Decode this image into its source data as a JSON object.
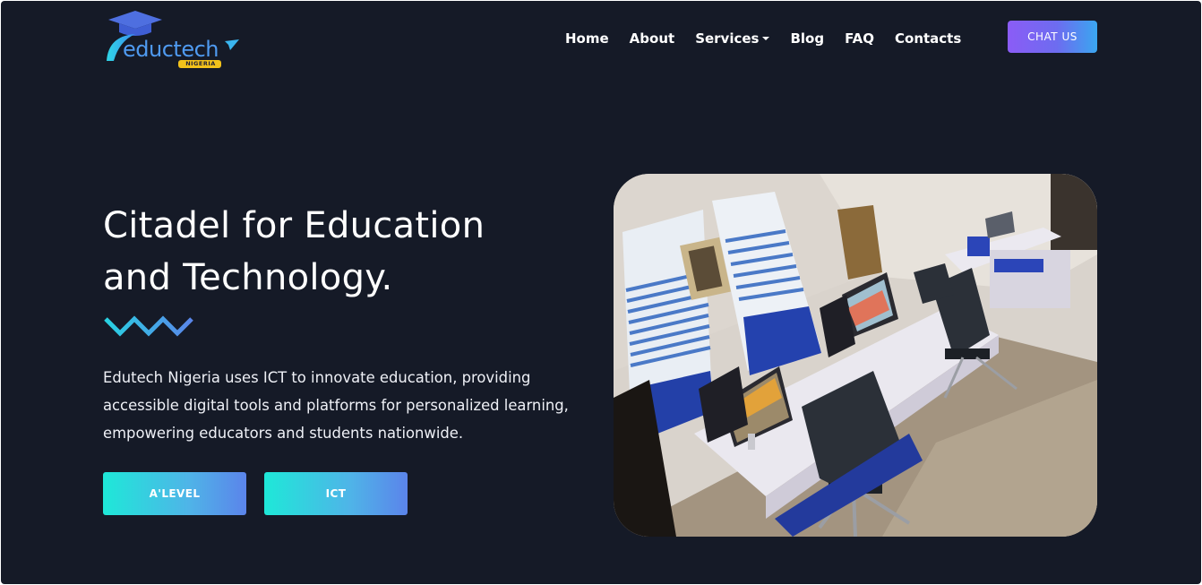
{
  "brand": {
    "logo_text": "eductech",
    "logo_sub": "NIGERIA",
    "logo_icon": "graduation-cap-icon"
  },
  "nav": {
    "items": [
      {
        "label": "Home"
      },
      {
        "label": "About"
      },
      {
        "label": "Services",
        "has_dropdown": true
      },
      {
        "label": "Blog"
      },
      {
        "label": "FAQ"
      },
      {
        "label": "Contacts"
      }
    ],
    "chat_label": "CHAT US"
  },
  "hero": {
    "title_line1": "Citadel for Education",
    "title_line2": "and Technology.",
    "desc_line1": "Edutech Nigeria uses ICT to innovate education, providing",
    "desc_line2": "accessible digital tools and platforms for personalized learning,",
    "desc_line3": "empowering educators and students nationwide.",
    "buttons": [
      {
        "label": "A'LEVEL"
      },
      {
        "label": "ICT"
      }
    ]
  },
  "colors": {
    "background": "#151a27",
    "accent_gradient_start": "#1ee8d8",
    "accent_gradient_end": "#5b84ea",
    "chat_gradient_start": "#8b5cf6",
    "chat_gradient_end": "#3aa6f0"
  },
  "image": {
    "subject": "computer-lab-photo"
  }
}
